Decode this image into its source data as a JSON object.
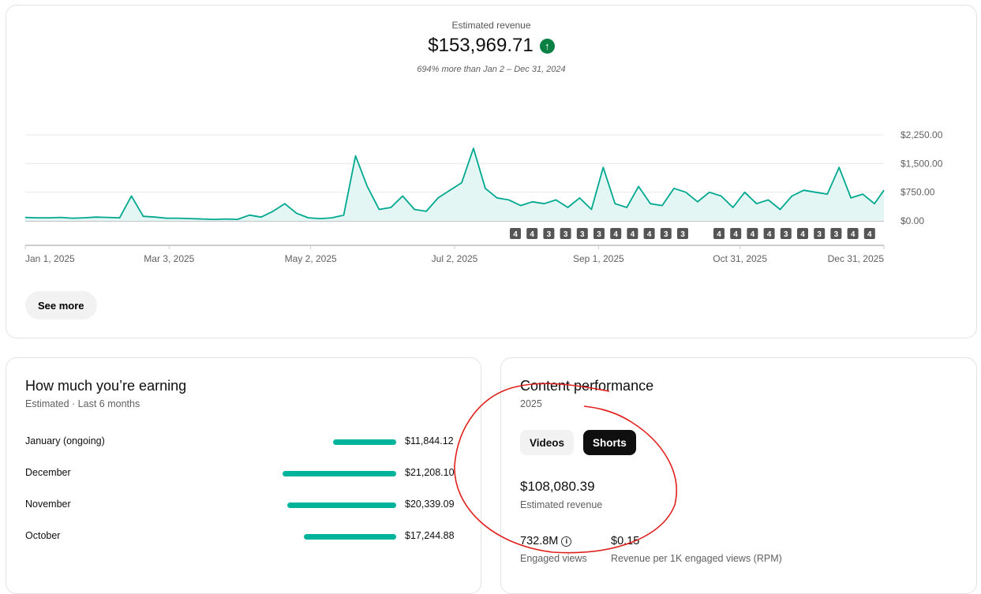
{
  "header": {
    "label": "Estimated revenue",
    "value": "$153,969.71",
    "trend_icon": "arrow-up-circle-icon",
    "comparison": "694% more than Jan 2 – Dec 31, 2024"
  },
  "see_more": "See more",
  "chart_data": {
    "type": "area",
    "title": "Estimated revenue",
    "x_unit": "day of 2025",
    "x": [
      0,
      5,
      10,
      15,
      20,
      25,
      30,
      35,
      40,
      45,
      50,
      55,
      60,
      65,
      70,
      75,
      80,
      85,
      90,
      95,
      100,
      105,
      110,
      115,
      120,
      125,
      130,
      135,
      140,
      145,
      150,
      155,
      160,
      165,
      170,
      175,
      180,
      185,
      190,
      195,
      200,
      205,
      210,
      215,
      220,
      225,
      230,
      235,
      240,
      245,
      250,
      255,
      260,
      265,
      270,
      275,
      280,
      285,
      290,
      295,
      300,
      305,
      310,
      315,
      320,
      325,
      330,
      335,
      340,
      345,
      350,
      355,
      360,
      364
    ],
    "values": [
      90,
      80,
      80,
      90,
      70,
      80,
      100,
      90,
      80,
      650,
      120,
      100,
      70,
      70,
      60,
      50,
      40,
      50,
      40,
      150,
      100,
      250,
      450,
      200,
      80,
      60,
      80,
      150,
      1700,
      900,
      300,
      350,
      650,
      300,
      250,
      600,
      800,
      1000,
      1900,
      850,
      600,
      550,
      400,
      500,
      450,
      550,
      350,
      600,
      300,
      1400,
      450,
      350,
      900,
      450,
      400,
      850,
      750,
      500,
      750,
      650,
      350,
      750,
      450,
      550,
      300,
      650,
      800,
      750,
      700,
      1400,
      600,
      700,
      450,
      800
    ],
    "ylim": [
      0,
      2250
    ],
    "y_ticks": [
      "$0.00",
      "$750.00",
      "$1,500.00",
      "$2,250.00"
    ],
    "y_tick_values": [
      0,
      750,
      1500,
      2250
    ],
    "x_ticks": [
      "Jan 1, 2025",
      "Mar 3, 2025",
      "May 2, 2025",
      "Jul 2, 2025",
      "Sep 1, 2025",
      "Oct 31, 2025",
      "Dec 31, 2025"
    ],
    "x_tick_days": [
      0,
      61,
      121,
      182,
      243,
      303,
      364
    ],
    "markers_group1": [
      "4",
      "4",
      "3",
      "3",
      "3",
      "3",
      "4",
      "4",
      "4",
      "3",
      "3"
    ],
    "markers_group2": [
      "4",
      "4",
      "4",
      "4",
      "3",
      "4",
      "3",
      "3",
      "4",
      "4"
    ],
    "color": "#00a88f"
  },
  "earning": {
    "title": "How much you’re earning",
    "subtitle": "Estimated · Last 6 months",
    "rows": [
      {
        "month": "January (ongoing)",
        "value": "$11,844.12",
        "amount": 11844.12
      },
      {
        "month": "December",
        "value": "$21,208.10",
        "amount": 21208.1
      },
      {
        "month": "November",
        "value": "$20,339.09",
        "amount": 20339.09
      },
      {
        "month": "October",
        "value": "$17,244.88",
        "amount": 17244.88
      }
    ]
  },
  "content": {
    "title": "Content performance",
    "subtitle": "2025",
    "tab_videos": "Videos",
    "tab_shorts": "Shorts",
    "revenue": "$108,080.39",
    "revenue_label": "Estimated revenue",
    "views": "732.8M",
    "views_label": "Engaged views",
    "rpm": "$0.15",
    "rpm_label": "Revenue per 1K engaged views (RPM)"
  }
}
